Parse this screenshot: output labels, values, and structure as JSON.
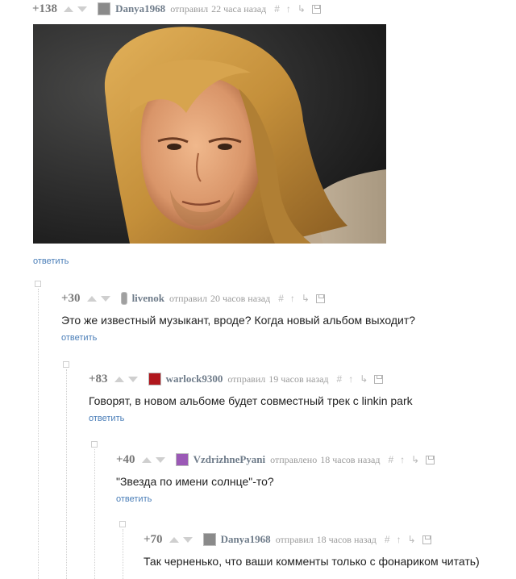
{
  "comments": [
    {
      "rating": "+138",
      "username": "Danya1968",
      "action": "отправил",
      "time": "22 часа назад",
      "reply": "ответить",
      "avatar_color": "#8a8a8a"
    },
    {
      "rating": "+30",
      "username": "livenok",
      "action": "отправил",
      "time": "20 часов назад",
      "text": "Это же известный музыкант, вроде? Когда новый альбом выходит?",
      "reply": "ответить",
      "avatar_color": "#a0a0a0"
    },
    {
      "rating": "+83",
      "username": "warlock9300",
      "action": "отправил",
      "time": "19 часов назад",
      "text": "Говорят, в новом альбоме будет совместный трек с linkin park",
      "reply": "ответить",
      "avatar_color": "#b0171d"
    },
    {
      "rating": "+40",
      "username": "VzdrizhnePyani",
      "action": "отправлено",
      "time": "18 часов назад",
      "text": "\"Звезда по имени солнце\"-то?",
      "reply": "ответить",
      "avatar_color": "#9b59b6"
    },
    {
      "rating": "+70",
      "username": "Danya1968",
      "action": "отправил",
      "time": "18 часов назад",
      "text": "Так черненько, что ваши комменты только с фонариком читать)",
      "avatar_color": "#8a8a8a"
    }
  ],
  "icons": {
    "up": "upvote-arrow-icon",
    "down": "downvote-arrow-icon",
    "hash": "hash-link-icon",
    "parent": "parent-arrow-icon",
    "thread": "thread-branch-icon",
    "save": "save-icon",
    "collapse": "collapse-thread-icon"
  },
  "colors": {
    "username": "#6f7c8a",
    "meta": "#9a9a9a",
    "reply_link": "#4a7eb8",
    "body_text": "#222222"
  }
}
